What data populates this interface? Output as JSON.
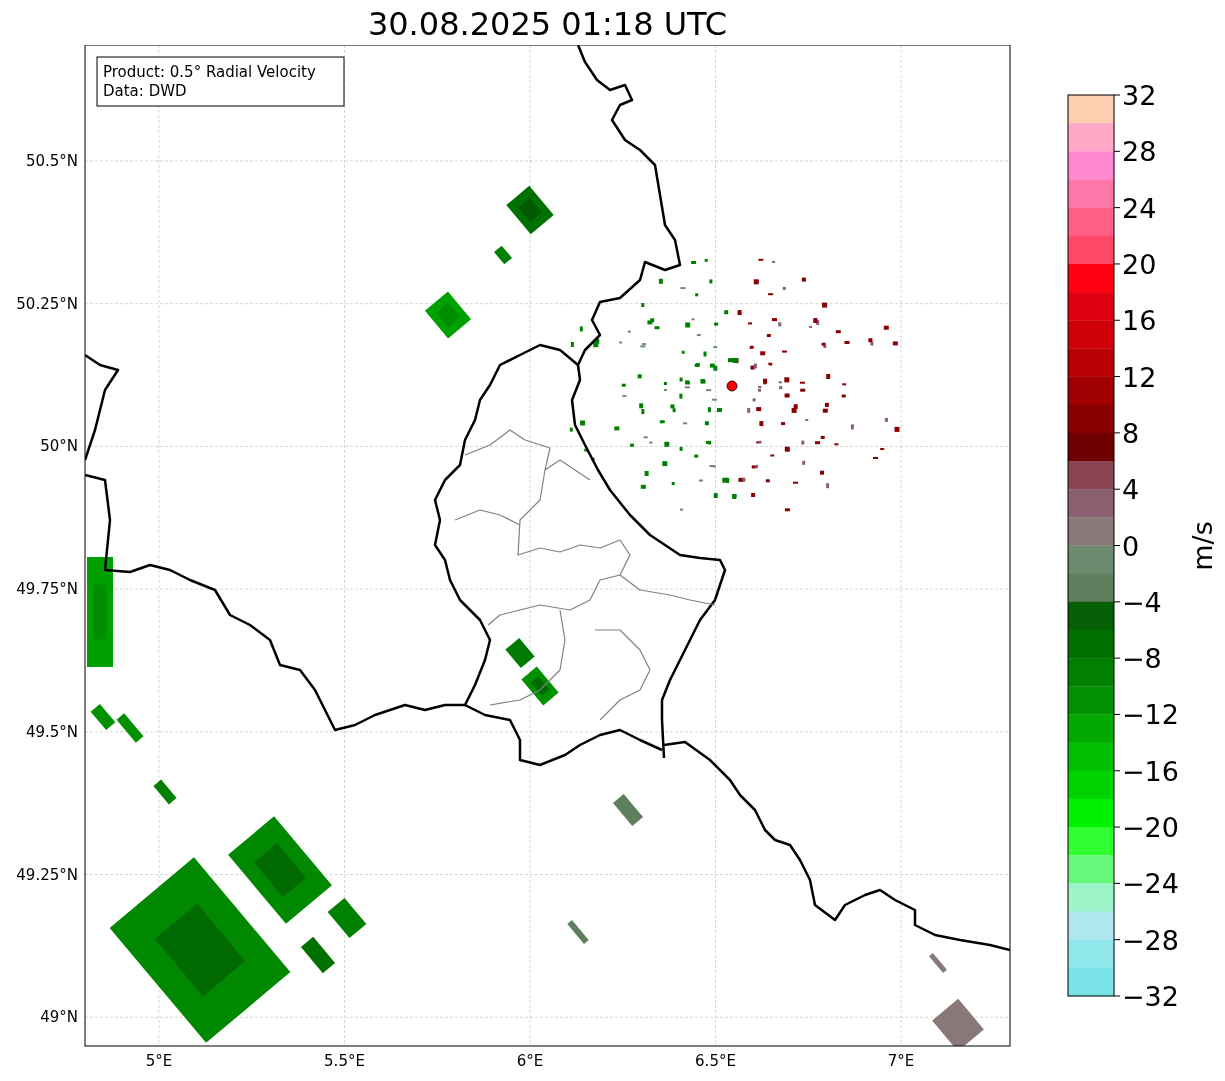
{
  "title": "30.08.2025 01:18 UTC",
  "legend_lines": [
    "Product: 0.5° Radial Velocity",
    "Data: DWD"
  ],
  "x_tick_labels": [
    "5°E",
    "5.5°E",
    "6°E",
    "6.5°E",
    "7°E"
  ],
  "y_tick_labels": [
    "50.5°N",
    "50.25°N",
    "50°N",
    "49.75°N",
    "49.5°N",
    "49.25°N",
    "49°N"
  ],
  "colorbar": {
    "label": "m/s",
    "tick_labels": [
      "32",
      "28",
      "24",
      "20",
      "16",
      "12",
      "8",
      "4",
      "0",
      "−4",
      "−8",
      "−12",
      "−16",
      "−20",
      "−24",
      "−28",
      "−32"
    ],
    "segments": [
      {
        "color": "#ffcdb0"
      },
      {
        "color": "#ffa8c8"
      },
      {
        "color": "#ff88d0"
      },
      {
        "color": "#ff77a8"
      },
      {
        "color": "#ff6088"
      },
      {
        "color": "#ff4868"
      },
      {
        "color": "#ff0010"
      },
      {
        "color": "#e00010"
      },
      {
        "color": "#d00008"
      },
      {
        "color": "#bb0005"
      },
      {
        "color": "#a00000"
      },
      {
        "color": "#880000"
      },
      {
        "color": "#700000"
      },
      {
        "color": "#8a4650"
      },
      {
        "color": "#8a6070"
      },
      {
        "color": "#8a7878"
      },
      {
        "color": "#6e8a6e"
      },
      {
        "color": "#5e7e5e"
      },
      {
        "color": "#056005"
      },
      {
        "color": "#006e00"
      },
      {
        "color": "#007f00"
      },
      {
        "color": "#009000"
      },
      {
        "color": "#00a800"
      },
      {
        "color": "#00be00"
      },
      {
        "color": "#00d400"
      },
      {
        "color": "#00f000"
      },
      {
        "color": "#30ff30"
      },
      {
        "color": "#66f87a"
      },
      {
        "color": "#9cf4c8"
      },
      {
        "color": "#b0e8ee"
      },
      {
        "color": "#90e8ec"
      },
      {
        "color": "#78e2e6"
      }
    ]
  }
}
